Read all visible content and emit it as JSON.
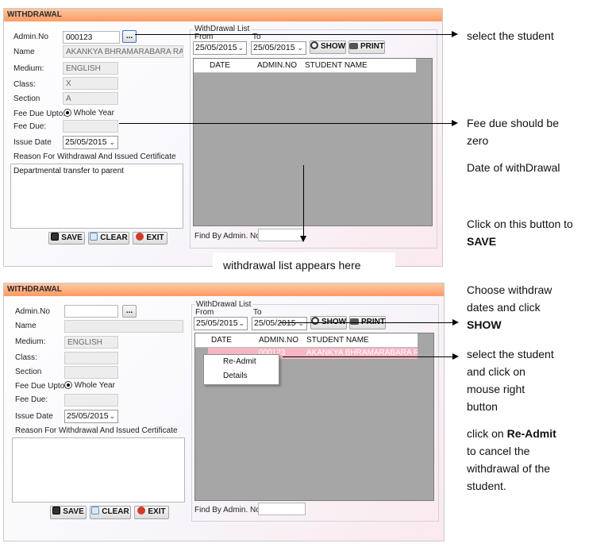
{
  "top_form": {
    "title": "WITHDRAWAL",
    "labels": {
      "admin_no": "Admin.No",
      "name": "Name",
      "medium": "Medium:",
      "class": "Class:",
      "section": "Section",
      "fee_due_upto": "Fee Due Upto:",
      "fee_due": "Fee Due:",
      "issue_date": "Issue Date",
      "reason": "Reason For Withdrawal And Issued Certificate"
    },
    "values": {
      "admin_no": "000123",
      "name": "AKANKYA BHRAMARABARA RAY",
      "medium": "ENGLISH",
      "class": "X",
      "section": "A",
      "fee_due_option": "Whole Year",
      "fee_due": "",
      "issue_date": "25/05/2015",
      "reason": "Departmental transfer to parent"
    },
    "browse_label": "...",
    "buttons": {
      "save": "SAVE",
      "clear": "CLEAR",
      "exit": "EXIT"
    },
    "list": {
      "group_title": "WithDrawal List",
      "from_label": "From",
      "to_label": "To",
      "from_date": "25/05/2015",
      "to_date": "25/05/2015",
      "show": "SHOW",
      "print": "PRINT",
      "columns": [
        "DATE",
        "ADMIN.NO",
        "STUDENT NAME"
      ],
      "find_label": "Find By Admin. No:",
      "find_value": ""
    }
  },
  "bottom_form": {
    "title": "WITHDRAWAL",
    "labels": {
      "admin_no": "Admin.No",
      "name": "Name",
      "medium": "Medium:",
      "class": "Class:",
      "section": "Section",
      "fee_due_upto": "Fee Due Upto:",
      "fee_due": "Fee Due:",
      "issue_date": "Issue Date",
      "reason": "Reason For Withdrawal And Issued Certificate"
    },
    "values": {
      "admin_no": "",
      "name": "",
      "medium": "ENGLISH",
      "class": "",
      "section": "",
      "fee_due_option": "Whole Year",
      "fee_due": "",
      "issue_date": "25/05/2015",
      "reason": ""
    },
    "browse_label": "...",
    "buttons": {
      "save": "SAVE",
      "clear": "CLEAR",
      "exit": "EXIT"
    },
    "list": {
      "group_title": "WithDrawal List",
      "from_label": "From",
      "to_label": "To",
      "from_date": "25/05/2015",
      "to_date": "25/05/2015",
      "show": "SHOW",
      "print": "PRINT",
      "columns": [
        "DATE",
        "ADMIN.NO",
        "STUDENT NAME"
      ],
      "selected_row": {
        "date": "",
        "admin_no": "000123",
        "student_name": "AKANKYA BHRAMARABARA RAY"
      },
      "context_menu": [
        "Re-Admit",
        "Details"
      ],
      "find_label": "Find By Admin. No:",
      "find_value": ""
    }
  },
  "annotations": {
    "select_student": "select the student",
    "fee_due_line1": "Fee due should be",
    "fee_due_line2": "zero",
    "date_of_withdrawal": "Date of withDrawal",
    "save_line1": "Click on this button to",
    "save_line2": "SAVE",
    "list_appears": "withdrawal   list appears here",
    "choose_line1": "Choose withdraw",
    "choose_line2": "dates and click",
    "choose_line3": "SHOW",
    "right_click_line1": "select the student",
    "right_click_line2": "and click on",
    "right_click_line3": "mouse right",
    "right_click_line4": "button",
    "readmit_line1_a": "click on ",
    "readmit_line1_b": "Re-Admit",
    "readmit_line2": "to cancel the",
    "readmit_line3": "withdrawal of the",
    "readmit_line4": "student."
  }
}
